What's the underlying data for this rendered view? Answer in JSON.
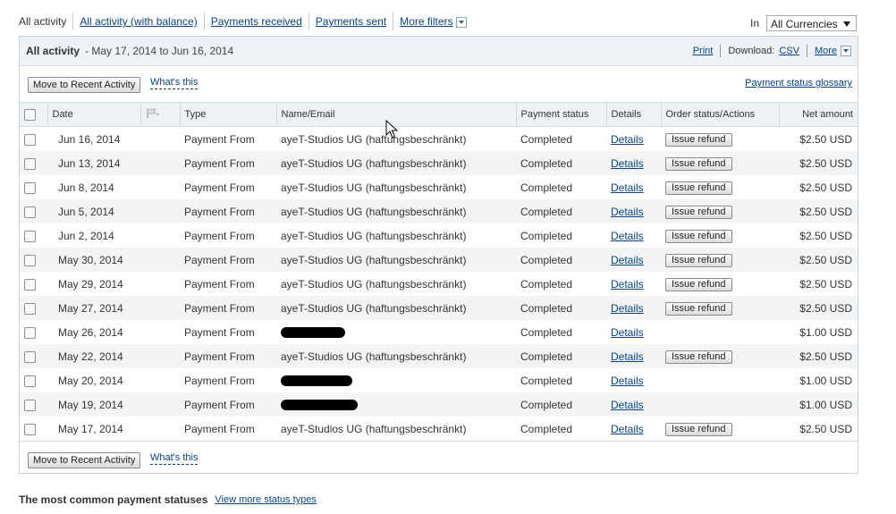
{
  "filters": {
    "tabs": [
      "All activity",
      "All activity (with balance)",
      "Payments received",
      "Payments sent",
      "More filters"
    ],
    "currency_label": "In",
    "currency_value": "All Currencies"
  },
  "panel": {
    "title": "All activity",
    "date_range": "- May 17, 2014 to Jun 16, 2014",
    "print": "Print",
    "download_label": "Download:",
    "csv": "CSV",
    "more": "More",
    "move_button": "Move to Recent Activity",
    "whats_this": "What's this",
    "glossary": "Payment status glossary"
  },
  "table": {
    "columns": [
      "Date",
      "Type",
      "Name/Email",
      "Payment status",
      "Details",
      "Order status/Actions",
      "Net amount"
    ],
    "rows": [
      {
        "date": "Jun 16, 2014",
        "type": "Payment From",
        "name": "ayeT-Studios UG (haftungsbeschränkt)",
        "status": "Completed",
        "details": "Details",
        "action": "Issue refund",
        "amount": "$2.50 USD"
      },
      {
        "date": "Jun 13, 2014",
        "type": "Payment From",
        "name": "ayeT-Studios UG (haftungsbeschränkt)",
        "status": "Completed",
        "details": "Details",
        "action": "Issue refund",
        "amount": "$2.50 USD"
      },
      {
        "date": "Jun 8, 2014",
        "type": "Payment From",
        "name": "ayeT-Studios UG (haftungsbeschränkt)",
        "status": "Completed",
        "details": "Details",
        "action": "Issue refund",
        "amount": "$2.50 USD"
      },
      {
        "date": "Jun 5, 2014",
        "type": "Payment From",
        "name": "ayeT-Studios UG (haftungsbeschränkt)",
        "status": "Completed",
        "details": "Details",
        "action": "Issue refund",
        "amount": "$2.50 USD"
      },
      {
        "date": "Jun 2, 2014",
        "type": "Payment From",
        "name": "ayeT-Studios UG (haftungsbeschränkt)",
        "status": "Completed",
        "details": "Details",
        "action": "Issue refund",
        "amount": "$2.50 USD"
      },
      {
        "date": "May 30, 2014",
        "type": "Payment From",
        "name": "ayeT-Studios UG (haftungsbeschränkt)",
        "status": "Completed",
        "details": "Details",
        "action": "Issue refund",
        "amount": "$2.50 USD"
      },
      {
        "date": "May 29, 2014",
        "type": "Payment From",
        "name": "ayeT-Studios UG (haftungsbeschränkt)",
        "status": "Completed",
        "details": "Details",
        "action": "Issue refund",
        "amount": "$2.50 USD"
      },
      {
        "date": "May 27, 2014",
        "type": "Payment From",
        "name": "ayeT-Studios UG (haftungsbeschränkt)",
        "status": "Completed",
        "details": "Details",
        "action": "Issue refund",
        "amount": "$2.50 USD"
      },
      {
        "date": "May 26, 2014",
        "type": "Payment From",
        "name": null,
        "status": "Completed",
        "details": "Details",
        "action": null,
        "amount": "$1.00 USD"
      },
      {
        "date": "May 22, 2014",
        "type": "Payment From",
        "name": "ayeT-Studios UG (haftungsbeschränkt)",
        "status": "Completed",
        "details": "Details",
        "action": "Issue refund",
        "amount": "$2.50 USD"
      },
      {
        "date": "May 20, 2014",
        "type": "Payment From",
        "name": null,
        "status": "Completed",
        "details": "Details",
        "action": null,
        "amount": "$1.00 USD"
      },
      {
        "date": "May 19, 2014",
        "type": "Payment From",
        "name": null,
        "status": "Completed",
        "details": "Details",
        "action": null,
        "amount": "$1.00 USD"
      },
      {
        "date": "May 17, 2014",
        "type": "Payment From",
        "name": "ayeT-Studios UG (haftungsbeschränkt)",
        "status": "Completed",
        "details": "Details",
        "action": "Issue refund",
        "amount": "$2.50 USD"
      }
    ]
  },
  "footer": {
    "label": "The most common payment statuses",
    "link": "View more status types"
  }
}
